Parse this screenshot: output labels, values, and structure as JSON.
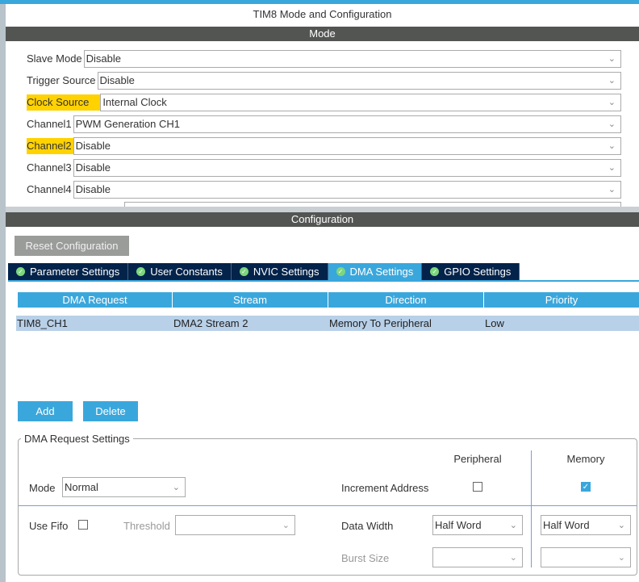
{
  "window_title": "TIM8 Mode and Configuration",
  "mode_header": "Mode",
  "mode_rows": [
    {
      "label": "Slave Mode",
      "value": "Disable",
      "highlighted": false
    },
    {
      "label": "Trigger Source",
      "value": "Disable",
      "highlighted": false
    },
    {
      "label": "Clock Source",
      "value": "Internal Clock",
      "highlighted": true
    },
    {
      "label": "Channel1",
      "value": "PWM Generation CH1",
      "highlighted": false
    },
    {
      "label": "Channel2",
      "value": "Disable",
      "highlighted": true
    },
    {
      "label": "Channel3",
      "value": "Disable",
      "highlighted": false
    },
    {
      "label": "Channel4",
      "value": "Disable",
      "highlighted": false
    }
  ],
  "config_header": "Configuration",
  "reset_label": "Reset Configuration",
  "tabs": [
    {
      "label": "Parameter Settings",
      "active": false
    },
    {
      "label": "User Constants",
      "active": false
    },
    {
      "label": "NVIC Settings",
      "active": false
    },
    {
      "label": "DMA Settings",
      "active": true
    },
    {
      "label": "GPIO Settings",
      "active": false
    }
  ],
  "dma_table": {
    "columns": [
      "DMA Request",
      "Stream",
      "Direction",
      "Priority"
    ],
    "rows": [
      [
        "TIM8_CH1",
        "DMA2 Stream 2",
        "Memory To Peripheral",
        "Low"
      ]
    ]
  },
  "add_label": "Add",
  "delete_label": "Delete",
  "settings": {
    "legend": "DMA Request Settings",
    "peripheral_header": "Peripheral",
    "memory_header": "Memory",
    "mode_label": "Mode",
    "mode_value": "Normal",
    "increment_label": "Increment Address",
    "increment_peripheral": false,
    "increment_memory": true,
    "fifo_label": "Use Fifo",
    "use_fifo": false,
    "threshold_label": "Threshold",
    "threshold_value": "",
    "data_width_label": "Data Width",
    "data_width_peripheral": "Half Word",
    "data_width_memory": "Half Word",
    "burst_label": "Burst Size",
    "burst_peripheral": "",
    "burst_memory": ""
  },
  "colors": {
    "accent": "#3aa7dc",
    "tab_dark": "#03234b",
    "highlight": "#ffd200",
    "header": "#535553",
    "row_selected": "#b8d0e8"
  }
}
